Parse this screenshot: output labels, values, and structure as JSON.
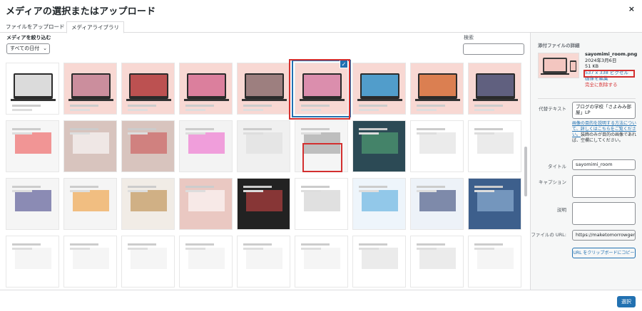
{
  "header": {
    "title": "メディアの選択またはアップロード",
    "close": "×"
  },
  "tabs": [
    {
      "label": "ファイルをアップロード"
    },
    {
      "label": "メディアライブラリ"
    }
  ],
  "toolbar": {
    "filter_label": "メディアを絞り込む",
    "date_filter": "すべての日付",
    "search_label": "検索",
    "search_value": ""
  },
  "grid": {
    "columns": 9,
    "selected_index": 5
  },
  "sidebar": {
    "heading": "添付ファイルの詳細",
    "filename": "sayomimi_room.png",
    "date": "2024年3月6日",
    "size": "51 KB",
    "dimensions": "537 x 338 ピクセル",
    "edit_link": "画像を編集",
    "delete_link": "完全に削除する",
    "alt_label": "代替テキスト",
    "alt_value": "ブログの学校「さよみみ部屋」LP",
    "help_link": "画像の目的を説明する方法について、詳しくはこちらをご覧ください。",
    "help_text": "装飾のみが目的の画像であれば、空欄にしてください。",
    "title_label": "タイトル",
    "title_value": "sayomimi_room",
    "caption_label": "キャプション",
    "caption_value": "",
    "desc_label": "説明",
    "desc_value": "",
    "url_label": "ファイルの URL:",
    "url_value": "https://maketomorrowgen",
    "copy_button": "URL をクリップボードにコピー"
  },
  "footer": {
    "select_button": "選択"
  },
  "colors": {
    "accent": "#2271b1",
    "highlight": "#d32f2f",
    "danger": "#d63638"
  }
}
